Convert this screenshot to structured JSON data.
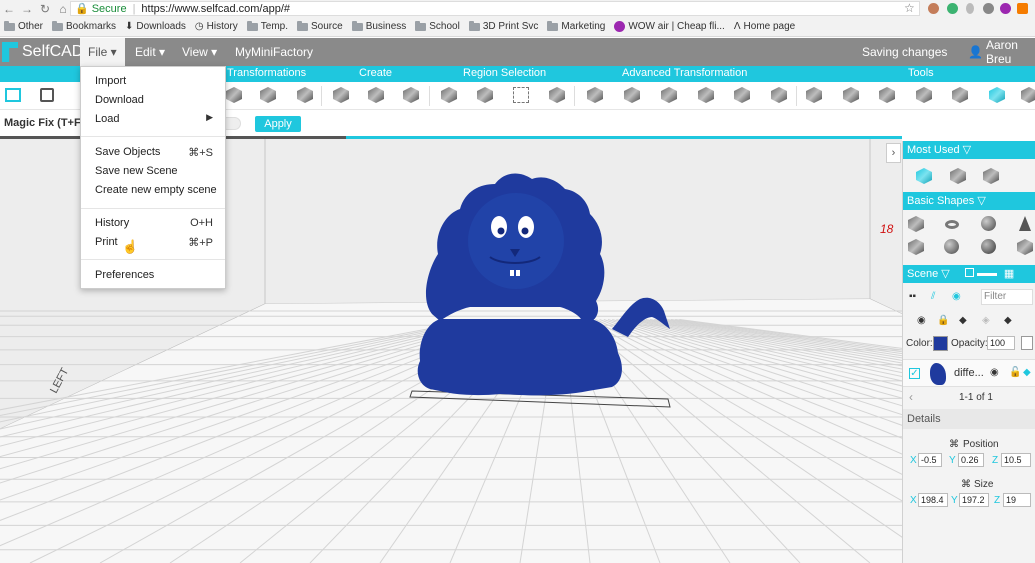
{
  "browser": {
    "secure_label": "Secure",
    "url": "https://www.selfcad.com/app/#",
    "bookmarks": [
      "Other",
      "Bookmarks",
      "Downloads",
      "History",
      "Temp.",
      "Source",
      "Business",
      "School",
      "3D Print Svc",
      "Marketing",
      "WOW air | Cheap fli...",
      "Home page"
    ]
  },
  "app": {
    "logo": "SelfCAD",
    "menu": {
      "file": "File",
      "edit": "Edit",
      "view": "View",
      "myminifactory": "MyMiniFactory"
    },
    "status": "Saving changes",
    "user": "Aaron Breu"
  },
  "categories": [
    "Transformations",
    "Create",
    "Region Selection",
    "Advanced Transformation",
    "Tools"
  ],
  "subbar": {
    "label": "Magic Fix (T+F)",
    "apply": "Apply"
  },
  "file_menu": {
    "import": "Import",
    "download": "Download",
    "load": "Load",
    "save_objects": "Save Objects",
    "save_objects_shortcut": "⌘+S",
    "save_new_scene": "Save new Scene",
    "create_empty": "Create new empty scene",
    "history": "History",
    "history_shortcut": "O+H",
    "print": "Print",
    "print_shortcut": "⌘+P",
    "preferences": "Preferences"
  },
  "viewport": {
    "left_label": "LEFT",
    "axis_label": "18"
  },
  "panel": {
    "most_used": "Most Used",
    "basic_shapes": "Basic Shapes",
    "scene": "Scene",
    "filter": "Filter",
    "color_label": "Color:",
    "opacity_label": "Opacity:",
    "opacity_value": "100",
    "object_name": "diffe...",
    "pagination": "1-1 of 1",
    "details": "Details",
    "position_label": "Position",
    "size_label": "Size",
    "pos_x": "-0.5",
    "pos_y": "0.26",
    "pos_z": "10.5",
    "size_x": "198.4",
    "size_y": "197.2",
    "size_z": "19",
    "x": "X",
    "y": "Y",
    "z": "Z"
  },
  "colors": {
    "accent": "#1fc7de",
    "menubar": "#8a8a8a",
    "model": "#1f3a9e"
  }
}
